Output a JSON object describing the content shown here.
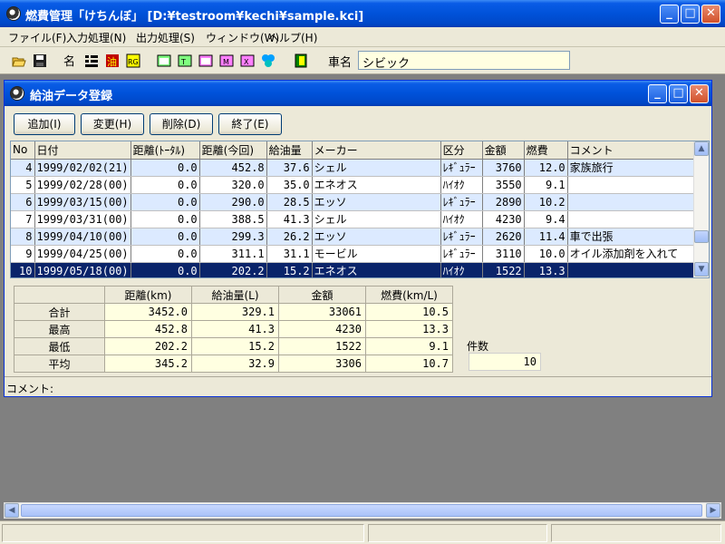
{
  "window": {
    "title": "燃費管理「けちんぼ」 [D:¥testroom¥kechi¥sample.kci]",
    "minimize": "_",
    "maximize": "□",
    "close": "✕"
  },
  "menu": [
    "ファイル(F)",
    "入力処理(N)",
    "出力処理(S)",
    "ウィンドウ(W)",
    "ヘルプ(H)"
  ],
  "toolbar": {
    "car_label": "車名",
    "car_value": "シビック",
    "icons": [
      "open-folder-icon",
      "save-icon",
      "name-icon",
      "list-icon",
      "fuel-icon",
      "report-icon",
      "calendar-icon",
      "table-icon",
      "chart-icon",
      "graph-icon",
      "settings-icon",
      "help-icon",
      "exit-icon"
    ]
  },
  "child": {
    "title": "給油データ登録",
    "buttons": {
      "add": "追加(I)",
      "edit": "変更(H)",
      "delete": "削除(D)",
      "close": "終了(E)"
    },
    "columns": [
      "No",
      "日付",
      "距離(ﾄｰﾀﾙ)",
      "距離(今回)",
      "給油量",
      "メーカー",
      "区分",
      "金額",
      "燃費",
      "コメント"
    ],
    "rows": [
      {
        "no": "4",
        "date": "1999/02/02(21)",
        "total": "0.0",
        "trip": "452.8",
        "fuel": "37.6",
        "maker": "シェル",
        "type": "ﾚｷﾞｭﾗｰ",
        "cost": "3760",
        "eff": "12.0",
        "comment": "家族旅行",
        "style": "blue"
      },
      {
        "no": "5",
        "date": "1999/02/28(00)",
        "total": "0.0",
        "trip": "320.0",
        "fuel": "35.0",
        "maker": "エネオス",
        "type": "ﾊｲｵｸ",
        "cost": "3550",
        "eff": "9.1",
        "comment": "",
        "style": "white"
      },
      {
        "no": "6",
        "date": "1999/03/15(00)",
        "total": "0.0",
        "trip": "290.0",
        "fuel": "28.5",
        "maker": "エッソ",
        "type": "ﾚｷﾞｭﾗｰ",
        "cost": "2890",
        "eff": "10.2",
        "comment": "",
        "style": "blue"
      },
      {
        "no": "7",
        "date": "1999/03/31(00)",
        "total": "0.0",
        "trip": "388.5",
        "fuel": "41.3",
        "maker": "シェル",
        "type": "ﾊｲｵｸ",
        "cost": "4230",
        "eff": "9.4",
        "comment": "",
        "style": "white"
      },
      {
        "no": "8",
        "date": "1999/04/10(00)",
        "total": "0.0",
        "trip": "299.3",
        "fuel": "26.2",
        "maker": "エッソ",
        "type": "ﾚｷﾞｭﾗｰ",
        "cost": "2620",
        "eff": "11.4",
        "comment": "車で出張",
        "style": "blue"
      },
      {
        "no": "9",
        "date": "1999/04/25(00)",
        "total": "0.0",
        "trip": "311.1",
        "fuel": "31.1",
        "maker": "モービル",
        "type": "ﾚｷﾞｭﾗｰ",
        "cost": "3110",
        "eff": "10.0",
        "comment": "オイル添加剤を入れて",
        "style": "white"
      },
      {
        "no": "10",
        "date": "1999/05/18(00)",
        "total": "0.0",
        "trip": "202.2",
        "fuel": "15.2",
        "maker": "エネオス",
        "type": "ﾊｲｵｸ",
        "cost": "1522",
        "eff": "13.3",
        "comment": "",
        "style": "sel"
      }
    ],
    "summary": {
      "headers": [
        "距離(km)",
        "給油量(L)",
        "金額",
        "燃費(km/L)"
      ],
      "rows": [
        {
          "label": "合計",
          "values": [
            "3452.0",
            "329.1",
            "33061",
            "10.5"
          ]
        },
        {
          "label": "最高",
          "values": [
            "452.8",
            "41.3",
            "4230",
            "13.3"
          ]
        },
        {
          "label": "最低",
          "values": [
            "202.2",
            "15.2",
            "1522",
            "9.1"
          ]
        },
        {
          "label": "平均",
          "values": [
            "345.2",
            "32.9",
            "3306",
            "10.7"
          ]
        }
      ],
      "count_label": "件数",
      "count_value": "10"
    },
    "comment_label": "コメント:"
  },
  "scroll": {
    "up": "▲",
    "down": "▼",
    "left": "◀",
    "right": "▶"
  }
}
